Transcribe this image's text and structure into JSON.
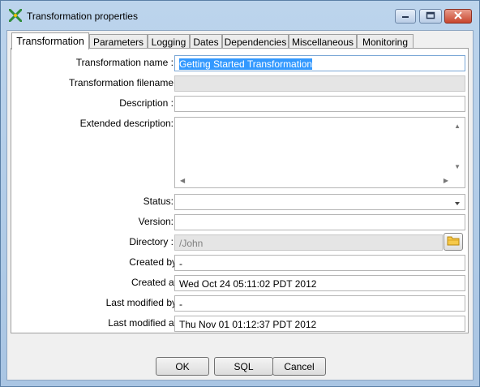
{
  "window": {
    "title": "Transformation properties"
  },
  "tabs": [
    {
      "label": "Transformation",
      "active": true
    },
    {
      "label": "Parameters"
    },
    {
      "label": "Logging"
    },
    {
      "label": "Dates"
    },
    {
      "label": "Dependencies"
    },
    {
      "label": "Miscellaneous"
    },
    {
      "label": "Monitoring"
    }
  ],
  "form": {
    "name_label": "Transformation name :",
    "name_value": "Getting Started Transformation",
    "filename_label": "Transformation filename",
    "filename_value": "",
    "description_label": "Description :",
    "description_value": "",
    "extended_label": "Extended description:",
    "extended_value": "",
    "status_label": "Status:",
    "status_value": "",
    "version_label": "Version:",
    "version_value": "",
    "directory_label": "Directory :",
    "directory_value": "/John",
    "created_by_label": "Created by",
    "created_by_value": "-",
    "created_at_label": "Created at",
    "created_at_value": "Wed Oct 24 05:11:02 PDT 2012",
    "modified_by_label": "Last modified by",
    "modified_by_value": "-",
    "modified_at_label": "Last modified at",
    "modified_at_value": "Thu Nov 01 01:12:37 PDT 2012"
  },
  "buttons": {
    "ok": "OK",
    "sql": "SQL",
    "cancel": "Cancel"
  },
  "icons": {
    "app": "kettle-transformation-icon",
    "minimize": "minimize-icon",
    "maximize": "maximize-icon",
    "close": "close-icon",
    "folder": "folder-icon",
    "dropdown": "chevron-down-icon"
  }
}
